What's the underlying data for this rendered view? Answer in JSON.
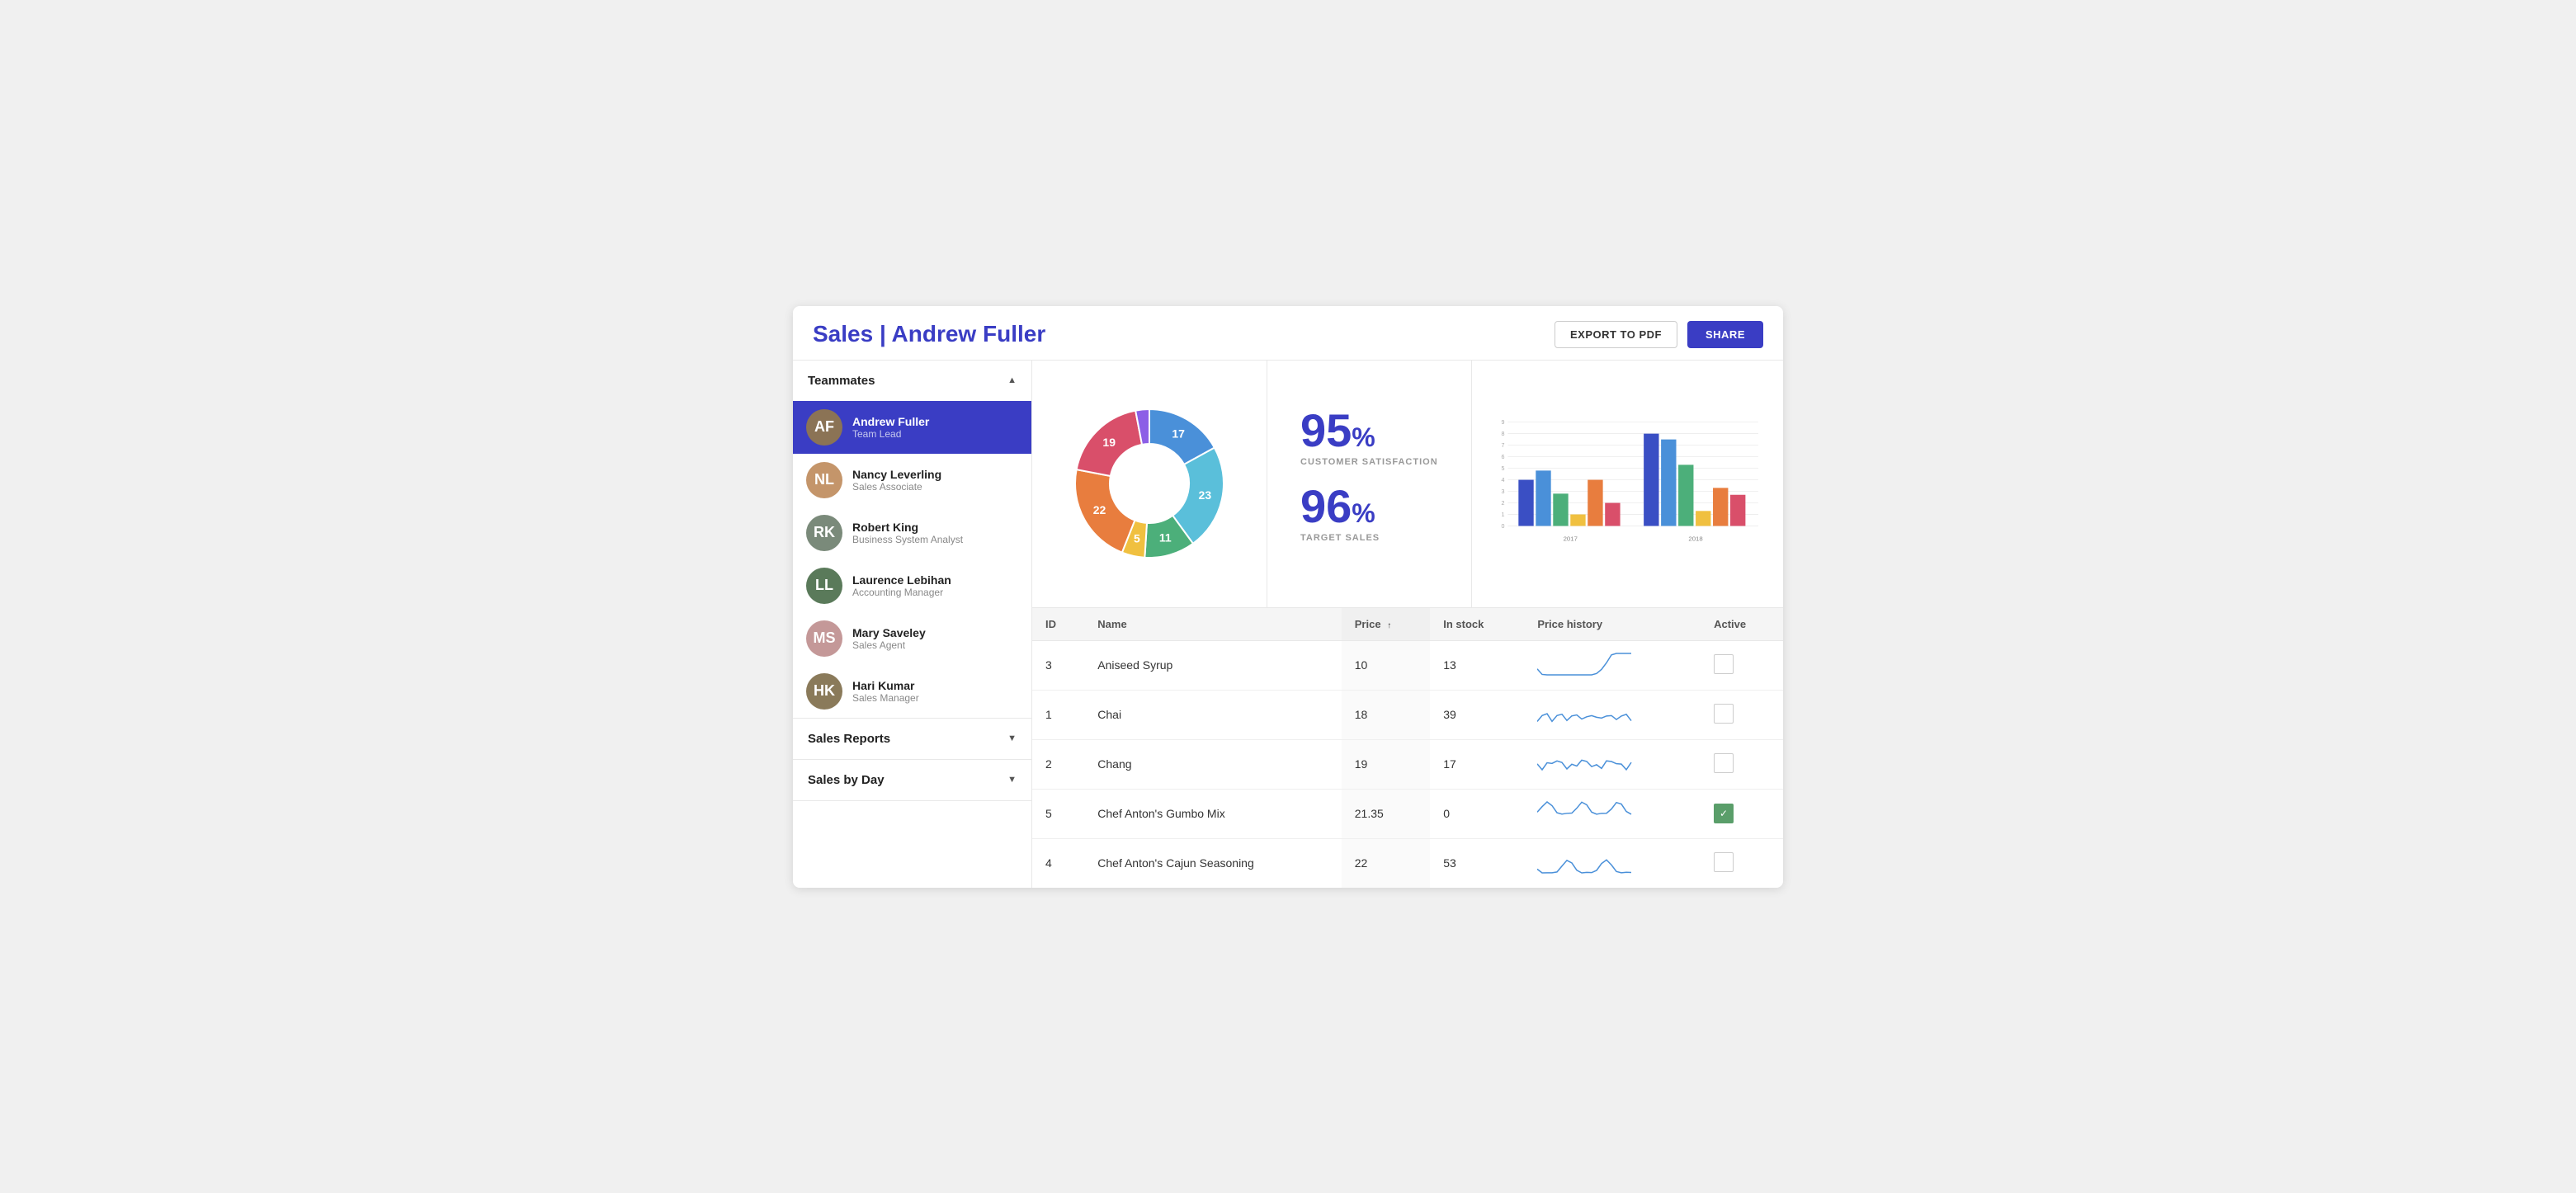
{
  "header": {
    "title": "Sales | Andrew Fuller",
    "export_label": "EXPORT TO PDF",
    "share_label": "SHARE"
  },
  "sidebar": {
    "teammates_label": "Teammates",
    "teammates_arrow": "▲",
    "sales_reports_label": "Sales Reports",
    "sales_reports_arrow": "▼",
    "sales_by_day_label": "Sales by Day",
    "sales_by_day_arrow": "▼",
    "teammates": [
      {
        "id": "andrew",
        "name": "Andrew Fuller",
        "role": "Team Lead",
        "active": true,
        "initials": "AF"
      },
      {
        "id": "nancy",
        "name": "Nancy Leverling",
        "role": "Sales Associate",
        "active": false,
        "initials": "NL"
      },
      {
        "id": "robert",
        "name": "Robert King",
        "role": "Business System Analyst",
        "active": false,
        "initials": "RK"
      },
      {
        "id": "laurence",
        "name": "Laurence Lebihan",
        "role": "Accounting Manager",
        "active": false,
        "initials": "LL"
      },
      {
        "id": "mary",
        "name": "Mary Saveley",
        "role": "Sales Agent",
        "active": false,
        "initials": "MS"
      },
      {
        "id": "hari",
        "name": "Hari Kumar",
        "role": "Sales Manager",
        "active": false,
        "initials": "HK"
      }
    ]
  },
  "kpi": {
    "satisfaction_value": "95",
    "satisfaction_pct": "%",
    "satisfaction_label": "CUSTOMER SATISFACTION",
    "target_value": "96",
    "target_pct": "%",
    "target_label": "TARGET SALES"
  },
  "donut": {
    "segments": [
      {
        "label": "17",
        "value": 17,
        "color": "#4a90d9"
      },
      {
        "label": "23",
        "value": 23,
        "color": "#5abfda"
      },
      {
        "label": "11",
        "value": 11,
        "color": "#4caf7a"
      },
      {
        "label": "5",
        "value": 5,
        "color": "#f0c040"
      },
      {
        "label": "22",
        "value": 22,
        "color": "#e87d3e"
      },
      {
        "label": "19",
        "value": 19,
        "color": "#d94f6a"
      },
      {
        "label": "3",
        "value": 3,
        "color": "#8c5fe6"
      }
    ]
  },
  "bar_chart": {
    "years": [
      "2017",
      "2018"
    ],
    "groups": [
      {
        "year": "2017",
        "bars": [
          {
            "value": 4,
            "color": "#3a4fc4"
          },
          {
            "value": 4.8,
            "color": "#4a90d9"
          },
          {
            "value": 2.8,
            "color": "#4caf7a"
          },
          {
            "value": 1,
            "color": "#f0c040"
          },
          {
            "value": 4,
            "color": "#e87d3e"
          },
          {
            "value": 2,
            "color": "#d94f6a"
          }
        ]
      },
      {
        "year": "2018",
        "bars": [
          {
            "value": 8,
            "color": "#3a4fc4"
          },
          {
            "value": 7.5,
            "color": "#4a90d9"
          },
          {
            "value": 5.3,
            "color": "#4caf7a"
          },
          {
            "value": 1.3,
            "color": "#f0c040"
          },
          {
            "value": 3.3,
            "color": "#e87d3e"
          },
          {
            "value": 2.7,
            "color": "#d94f6a"
          }
        ]
      }
    ],
    "y_max": 9,
    "y_labels": [
      "0",
      "1",
      "2",
      "3",
      "4",
      "5",
      "6",
      "7",
      "8",
      "9"
    ]
  },
  "table": {
    "columns": [
      {
        "key": "id",
        "label": "ID"
      },
      {
        "key": "name",
        "label": "Name"
      },
      {
        "key": "price",
        "label": "Price",
        "sorted": true,
        "sort_dir": "asc"
      },
      {
        "key": "instock",
        "label": "In stock"
      },
      {
        "key": "price_history",
        "label": "Price history"
      },
      {
        "key": "active",
        "label": "Active"
      }
    ],
    "rows": [
      {
        "id": 3,
        "name": "Aniseed Syrup",
        "price": "10",
        "instock": 13,
        "active": false
      },
      {
        "id": 1,
        "name": "Chai",
        "price": "18",
        "instock": 39,
        "active": false
      },
      {
        "id": 2,
        "name": "Chang",
        "price": "19",
        "instock": 17,
        "active": false
      },
      {
        "id": 5,
        "name": "Chef Anton's Gumbo Mix",
        "price": "21.35",
        "instock": 0,
        "active": true
      },
      {
        "id": 4,
        "name": "Chef Anton's Cajun Seasoning",
        "price": "22",
        "instock": 53,
        "active": false
      }
    ]
  }
}
